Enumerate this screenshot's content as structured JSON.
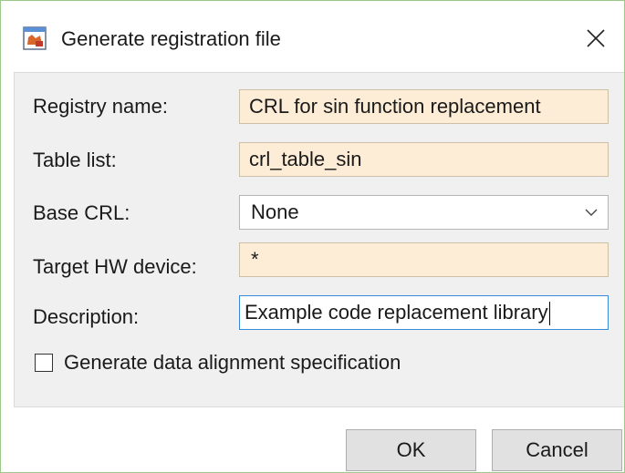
{
  "dialog": {
    "title": "Generate registration file",
    "close_glyph": "✕"
  },
  "form": {
    "registry_name": {
      "label": "Registry name:",
      "value": "CRL for sin function replacement"
    },
    "table_list": {
      "label": "Table list:",
      "value": "crl_table_sin"
    },
    "base_crl": {
      "label": "Base CRL:",
      "value": "None"
    },
    "target_hw_device": {
      "label": "Target HW device:",
      "value": "*"
    },
    "description": {
      "label": "Description:",
      "value": "Example code replacement library"
    },
    "alignment_checkbox": {
      "label": "Generate data alignment specification",
      "checked": false
    }
  },
  "buttons": {
    "ok": "OK",
    "cancel": "Cancel"
  },
  "colors": {
    "field_bg": "#fdecd6",
    "panel_bg": "#f0f0f0",
    "focus_border": "#3b8ad9"
  },
  "icons": {
    "app": "matlab-window-icon",
    "close": "close-icon",
    "dropdown": "chevron-down-icon"
  }
}
